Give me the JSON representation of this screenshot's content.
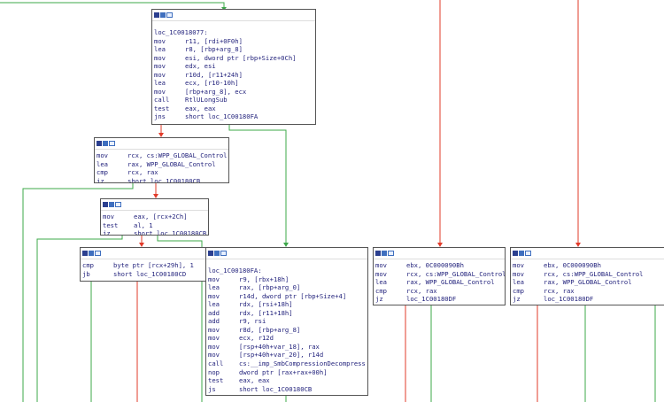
{
  "graph": {
    "colors": {
      "true_edge": "#3ca84a",
      "false_edge": "#e23b2a",
      "uncond_edge": "#3a4cc8",
      "text": "#1f1f7a",
      "import": "#d000d0"
    },
    "nodes": {
      "n1": {
        "label": "loc_1C0018077:",
        "lines": [
          {
            "mn": "mov",
            "op": "r11, [rdi+0F0h]"
          },
          {
            "mn": "lea",
            "op": "r8, [rbp+arg_8]"
          },
          {
            "mn": "mov",
            "op": "esi, dword ptr [rbp+Size+0Ch]"
          },
          {
            "mn": "mov",
            "op": "edx, esi"
          },
          {
            "mn": "mov",
            "op": "r10d, [r11+24h]"
          },
          {
            "mn": "lea",
            "op": "ecx, [r10-10h]"
          },
          {
            "mn": "mov",
            "op": "[rbp+arg_8], ecx"
          },
          {
            "mn": "call",
            "op": "RtlULongSub"
          },
          {
            "mn": "test",
            "op": "eax, eax"
          },
          {
            "mn": "jns",
            "op": "short loc_1C00180FA"
          }
        ]
      },
      "n2": {
        "lines": [
          {
            "mn": "mov",
            "op": "rcx, cs:WPP_GLOBAL_Control"
          },
          {
            "mn": "lea",
            "op": "rax, WPP_GLOBAL_Control"
          },
          {
            "mn": "cmp",
            "op": "rcx, rax"
          },
          {
            "mn": "jz",
            "op": "short loc_1C00180CB"
          }
        ]
      },
      "n3": {
        "lines": [
          {
            "mn": "mov",
            "op": "eax, [rcx+2Ch]"
          },
          {
            "mn": "test",
            "op": "al, 1"
          },
          {
            "mn": "jz",
            "op": "short loc_1C00180CB"
          }
        ]
      },
      "n4": {
        "lines": [
          {
            "mn": "cmp",
            "op": "byte ptr [rcx+29h], 1"
          },
          {
            "mn": "jb",
            "op": "short loc_1C00180CD"
          }
        ]
      },
      "n5": {
        "label": "loc_1C00180FA:",
        "lines": [
          {
            "mn": "mov",
            "op": "r9, [rbx+18h]"
          },
          {
            "mn": "lea",
            "op": "rax, [rbp+arg_0]"
          },
          {
            "mn": "mov",
            "op": "r14d, dword ptr [rbp+Size+4]"
          },
          {
            "mn": "lea",
            "op": "rdx, [rsi+18h]"
          },
          {
            "mn": "add",
            "op": "rdx, [r11+18h]"
          },
          {
            "mn": "add",
            "op": "r9, rsi"
          },
          {
            "mn": "mov",
            "op": "r8d, [rbp+arg_8]"
          },
          {
            "mn": "mov",
            "op": "ecx, r12d"
          },
          {
            "mn": "mov",
            "op": "[rsp+40h+var_18], rax"
          },
          {
            "mn": "mov",
            "op": "[rsp+40h+var_20], r14d"
          },
          {
            "mn": "call",
            "op": "cs:__imp_SmbCompressionDecompress",
            "imp": true
          },
          {
            "mn": "nop",
            "op": "dword ptr [rax+rax+00h]"
          },
          {
            "mn": "test",
            "op": "eax, eax"
          },
          {
            "mn": "js",
            "op": "short loc_1C00180CB"
          }
        ]
      },
      "n6": {
        "lines": [
          {
            "mn": "mov",
            "op": "ebx, 0C000090Bh"
          },
          {
            "mn": "mov",
            "op": "rcx, cs:WPP_GLOBAL_Control"
          },
          {
            "mn": "lea",
            "op": "rax, WPP_GLOBAL_Control"
          },
          {
            "mn": "cmp",
            "op": "rcx, rax"
          },
          {
            "mn": "jz",
            "op": "loc_1C00180DF"
          }
        ]
      },
      "n7": {
        "lines": [
          {
            "mn": "mov",
            "op": "ebx, 0C000090Bh"
          },
          {
            "mn": "mov",
            "op": "rcx, cs:WPP_GLOBAL_Control"
          },
          {
            "mn": "lea",
            "op": "rax, WPP_GLOBAL_Control"
          },
          {
            "mn": "cmp",
            "op": "rcx, rax"
          },
          {
            "mn": "jz",
            "op": "loc_1C00180DF"
          }
        ]
      }
    }
  }
}
